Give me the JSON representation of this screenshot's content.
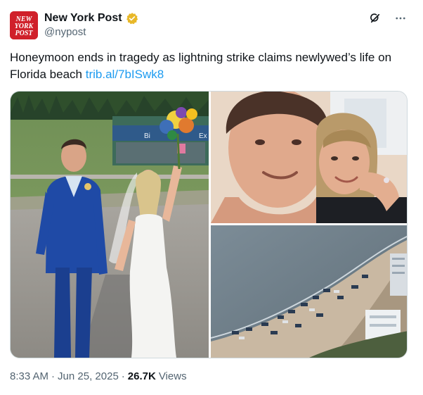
{
  "account": {
    "display_name": "New York Post",
    "handle": "@nypost",
    "logo_lines": [
      "NEW",
      "YORK",
      "POST"
    ],
    "verified_badge": "gold-verified-badge-icon"
  },
  "toolbar": {
    "grok_icon": "grok-icon",
    "more_icon": "more-options-icon"
  },
  "tweet": {
    "text": "Honeymoon ends in tragedy as lightning strike claims newlywed’s life on Florida beach ",
    "link": "trib.al/7bISwk8"
  },
  "media": [
    {
      "description": "wedding-photo",
      "sign_text": "Bi",
      "sign_text_right": "Ex"
    },
    {
      "description": "couple-selfie"
    },
    {
      "description": "aerial-beach-view"
    }
  ],
  "meta": {
    "time": "8:33 AM",
    "separator1": "·",
    "date": "Jun 25, 2025",
    "separator2": "·",
    "views_count": "26.7K",
    "views_label": "Views"
  },
  "colors": {
    "brand_red": "#d0202a",
    "link_blue": "#1d9bf0",
    "verified_gold": "#e8b829",
    "secondary_text": "#536471"
  }
}
